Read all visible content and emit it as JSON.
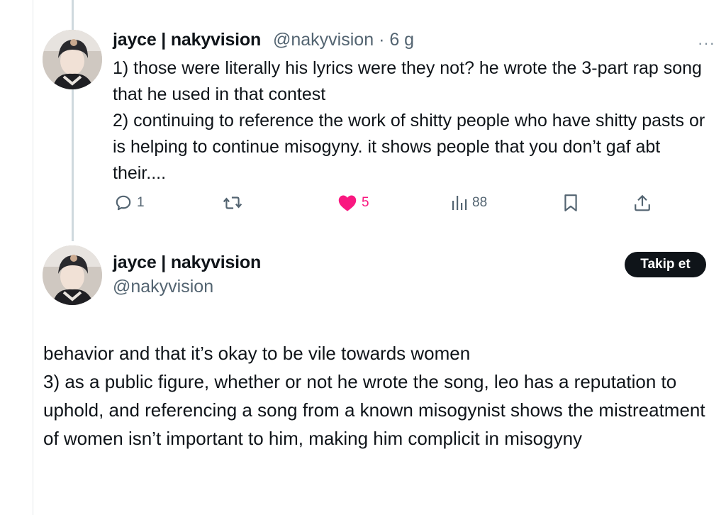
{
  "tweet1": {
    "display_name": "jayce | nakyvision",
    "handle": "@nakyvision",
    "time": "· 6 g",
    "more": "···",
    "text": "1) those were literally his lyrics were they not? he wrote the 3-part rap song that he used in that contest\n2) continuing to reference the work of shitty people who have shitty pasts or is helping to continue misogyny. it shows people that you don’t gaf abt their....",
    "actions": {
      "reply_count": "1",
      "retweet_count": "",
      "like_count": "5",
      "views_count": "88"
    }
  },
  "tweet2": {
    "display_name": "jayce | nakyvision",
    "handle": "@nakyvision",
    "follow_label": "Takip et",
    "text": "behavior and that it’s okay to be vile towards women\n3) as a public figure, whether or not he wrote the song, leo has a reputation to uphold, and referencing a song from a known misogynist shows the mistreatment of women isn’t important to him, making him complicit in misogyny"
  },
  "colors": {
    "like": "#f91880",
    "muted": "#536471",
    "text": "#0f1419",
    "button_bg": "#0f1419"
  },
  "icons": [
    "reply-icon",
    "retweet-icon",
    "like-icon",
    "views-icon",
    "bookmark-icon",
    "share-icon",
    "more-icon"
  ]
}
